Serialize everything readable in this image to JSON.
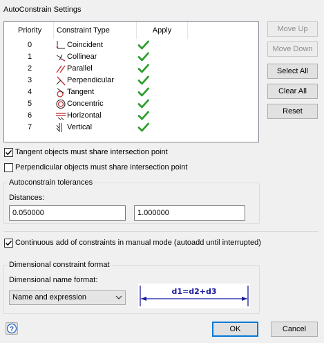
{
  "window_title": "AutoConstrain Settings",
  "table": {
    "headers": {
      "priority": "Priority",
      "type": "Constraint Type",
      "apply": "Apply"
    },
    "rows": [
      {
        "priority": "0",
        "type": "Coincident",
        "icon": "coincident-icon",
        "applied": true
      },
      {
        "priority": "1",
        "type": "Collinear",
        "icon": "collinear-icon",
        "applied": true
      },
      {
        "priority": "2",
        "type": "Parallel",
        "icon": "parallel-icon",
        "applied": true
      },
      {
        "priority": "3",
        "type": "Perpendicular",
        "icon": "perpendicular-icon",
        "applied": true
      },
      {
        "priority": "4",
        "type": "Tangent",
        "icon": "tangent-icon",
        "applied": true
      },
      {
        "priority": "5",
        "type": "Concentric",
        "icon": "concentric-icon",
        "applied": true
      },
      {
        "priority": "6",
        "type": "Horizontal",
        "icon": "horizontal-icon",
        "applied": true
      },
      {
        "priority": "7",
        "type": "Vertical",
        "icon": "vertical-icon",
        "applied": true
      }
    ]
  },
  "buttons": {
    "move_up": "Move Up",
    "move_down": "Move Down",
    "select_all": "Select All",
    "clear_all": "Clear All",
    "reset": "Reset",
    "ok": "OK",
    "cancel": "Cancel"
  },
  "options": {
    "tangent_share": {
      "label": "Tangent objects must share intersection point",
      "checked": true
    },
    "perpendicular_share": {
      "label": "Perpendicular objects must share intersection point",
      "checked": false
    },
    "continuous_add": {
      "label": "Continuous add of constraints in manual mode (autoadd until interrupted)",
      "checked": true
    }
  },
  "tolerances": {
    "group_label": "Autoconstrain tolerances",
    "distances_label": "Distances:",
    "distance_value": "0.050000",
    "angle_value": "1.000000"
  },
  "dimensional": {
    "group_label": "Dimensional constraint format",
    "name_format_label": "Dimensional name format:",
    "selected_format": "Name and expression",
    "preview_text": "d1=d2+d3"
  },
  "colors": {
    "check_green": "#2e9e2e",
    "preview_blue": "#1a1aa0",
    "icon_red": "#c0282d",
    "accent": "#0078d7"
  }
}
